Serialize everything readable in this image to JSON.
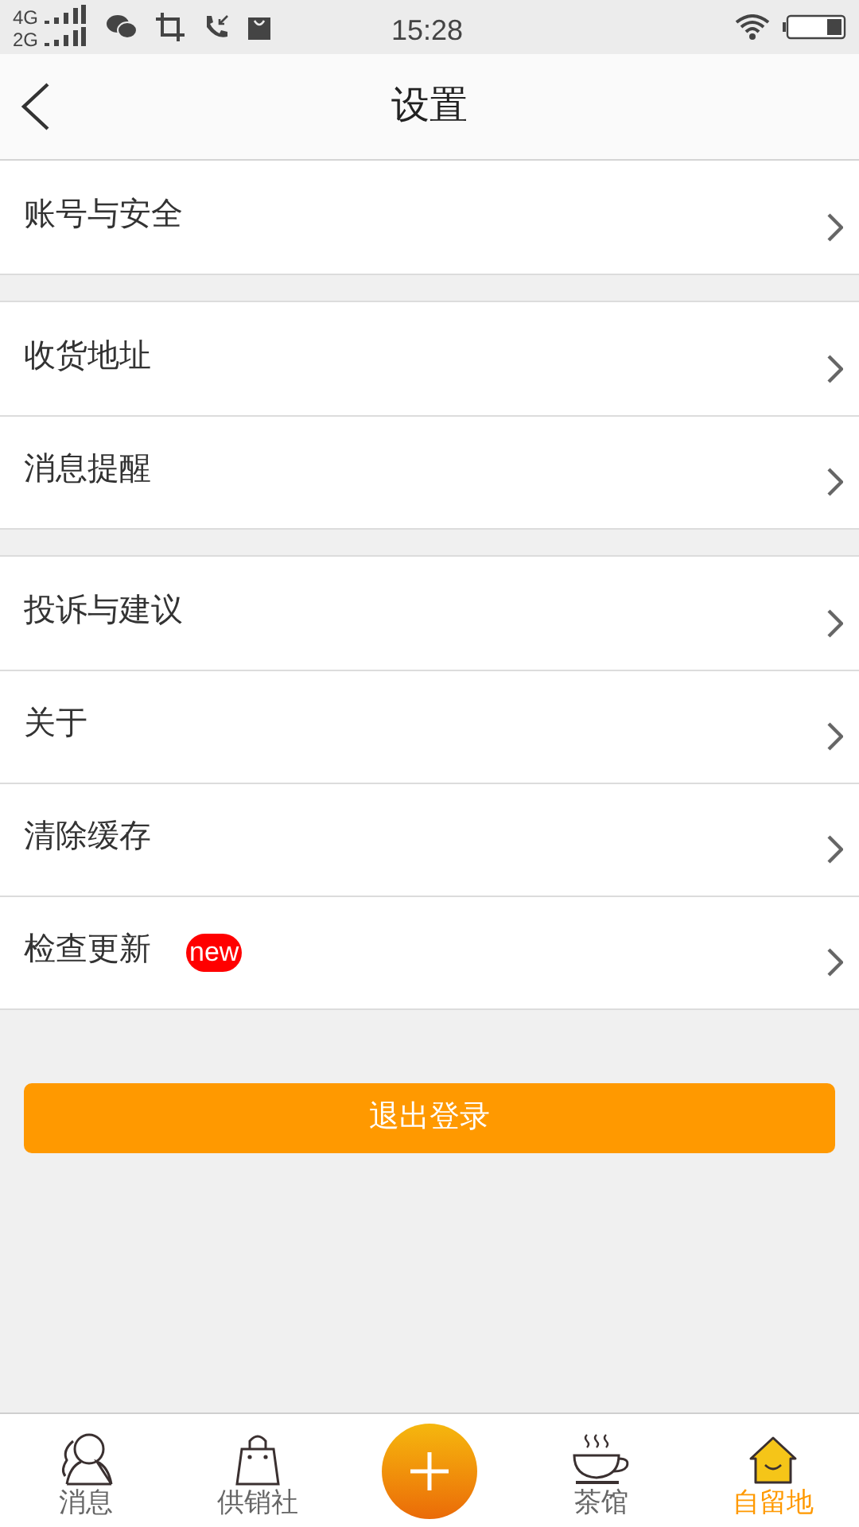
{
  "status_bar": {
    "networks": [
      "4G",
      "2G"
    ],
    "time": "15:28"
  },
  "header": {
    "title": "设置"
  },
  "groups": [
    {
      "items": [
        {
          "label": "账号与安全"
        }
      ]
    },
    {
      "items": [
        {
          "label": "收货地址"
        },
        {
          "label": "消息提醒"
        }
      ]
    },
    {
      "items": [
        {
          "label": "投诉与建议"
        },
        {
          "label": "关于"
        },
        {
          "label": "清除缓存"
        },
        {
          "label": "检查更新",
          "badge": "new"
        }
      ]
    }
  ],
  "logout_button": "退出登录",
  "nav": [
    {
      "kind": "messages",
      "label": "消息",
      "selected": false
    },
    {
      "kind": "shop",
      "label": "供销社",
      "selected": false
    },
    {
      "kind": "add"
    },
    {
      "kind": "tea",
      "label": "茶馆",
      "selected": false
    },
    {
      "kind": "home",
      "label": "自留地",
      "selected": true
    }
  ]
}
